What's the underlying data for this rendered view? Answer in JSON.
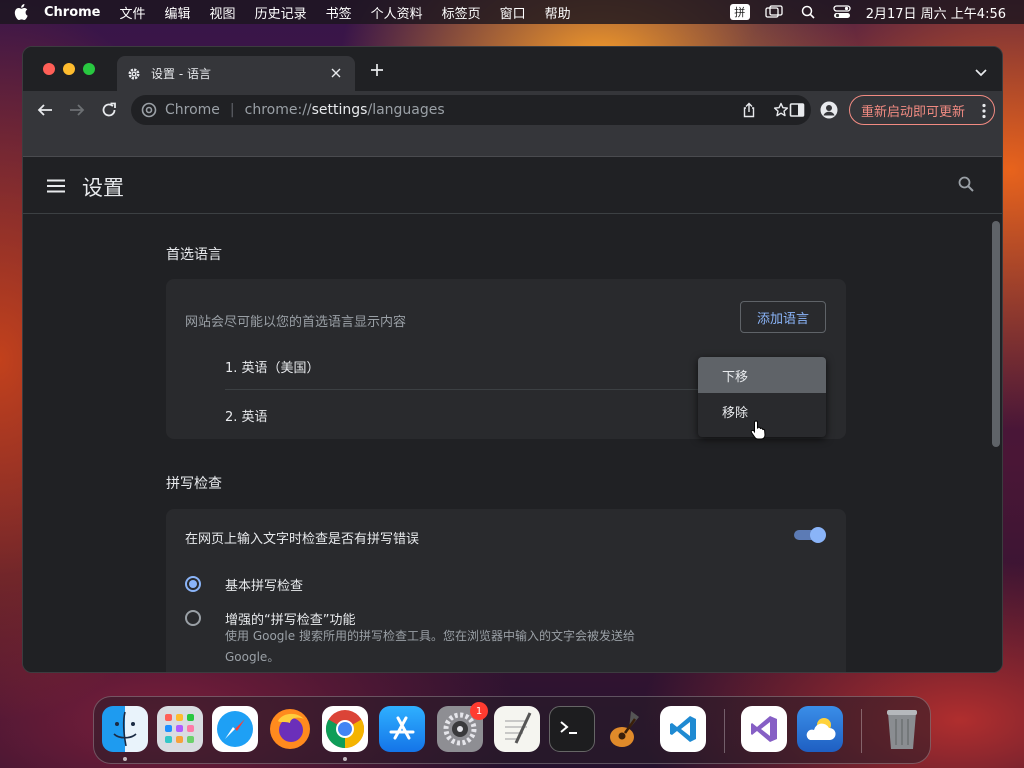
{
  "menubar": {
    "apple_icon": "apple-icon",
    "items": [
      "Chrome",
      "文件",
      "编辑",
      "视图",
      "历史记录",
      "书签",
      "个人资料",
      "标签页",
      "窗口",
      "帮助"
    ],
    "input_method": "拼",
    "clock": "2月17日 周六  上午4:56"
  },
  "browser": {
    "tab_title": "设置 - 语言",
    "url_site": "Chrome",
    "url_scheme": "chrome://",
    "url_host": "settings",
    "url_path": "/languages",
    "update_button": "重新启动即可更新"
  },
  "settings": {
    "title": "设置",
    "preferred_languages": {
      "heading": "首选语言",
      "description": "网站会尽可能以您的首选语言显示内容",
      "add_button": "添加语言",
      "languages": [
        "1. 英语（美国）",
        "2. 英语"
      ]
    },
    "context_menu": {
      "items": [
        "下移",
        "移除"
      ],
      "hovered": "下移"
    },
    "spellcheck": {
      "heading": "拼写检查",
      "toggle_label": "在网页上输入文字时检查是否有拼写错误",
      "toggle_on": true,
      "options": [
        {
          "label": "基本拼写检查",
          "checked": true,
          "description": ""
        },
        {
          "label": "增强的“拼写检查”功能",
          "checked": false,
          "description": "使用 Google 搜索所用的拼写检查工具。您在浏览器中输入的文字会被发送给 Google。"
        }
      ]
    }
  },
  "dock": {
    "apps": [
      "finder",
      "launchpad",
      "safari",
      "firefox",
      "chrome",
      "app-store",
      "system-settings",
      "textedit",
      "terminal",
      "garageband",
      "vscode",
      "visual-studio",
      "weather",
      "trash"
    ],
    "system_settings_badge": "1"
  },
  "colors": {
    "accent": "#8ab4f8",
    "update_red": "#f28b82",
    "page_bg": "#202124",
    "card_bg": "#292a2d"
  }
}
